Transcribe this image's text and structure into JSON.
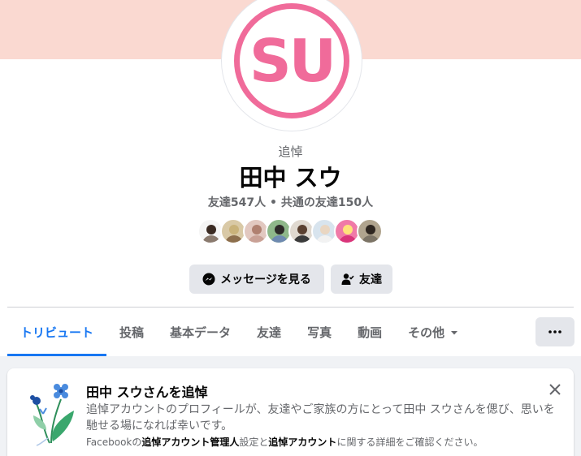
{
  "profile": {
    "memorial_label": "追悼",
    "name": "田中 スウ",
    "avatar_initials": "SU",
    "friend_stats": "友達547人 • 共通の友達150人"
  },
  "actions": {
    "message_label": "メッセージを見る",
    "friend_label": "友達"
  },
  "tabs": [
    {
      "label": "トリビュート",
      "active": true
    },
    {
      "label": "投稿"
    },
    {
      "label": "基本データ"
    },
    {
      "label": "友達"
    },
    {
      "label": "写真"
    },
    {
      "label": "動画"
    },
    {
      "label": "その他"
    }
  ],
  "tribute": {
    "title": "田中 スウさんを追悼",
    "body": "追悼アカウントのプロフィールが、友達やご家族の方にとって田中 スウさんを偲び、思いを馳せる場になれば幸いです。",
    "note_prefix": "Facebookの",
    "note_bold1": "追悼アカウント管理人",
    "note_middle": "設定と",
    "note_bold2": "追悼アカウント",
    "note_suffix": "に関する詳細をご確認ください。"
  },
  "colors": {
    "accent": "#1877f2",
    "cover": "#fad9d1",
    "avatar_pink": "#f06b9a",
    "button_bg": "#e4e6eb"
  },
  "icons": {
    "message_button": "messenger-icon",
    "friend_button": "friend-person-check-icon",
    "more_tab": "caret-down-icon",
    "more_button": "ellipsis-icon",
    "tribute_close": "close-icon",
    "tribute_art": "flower-bouquet-icon"
  }
}
